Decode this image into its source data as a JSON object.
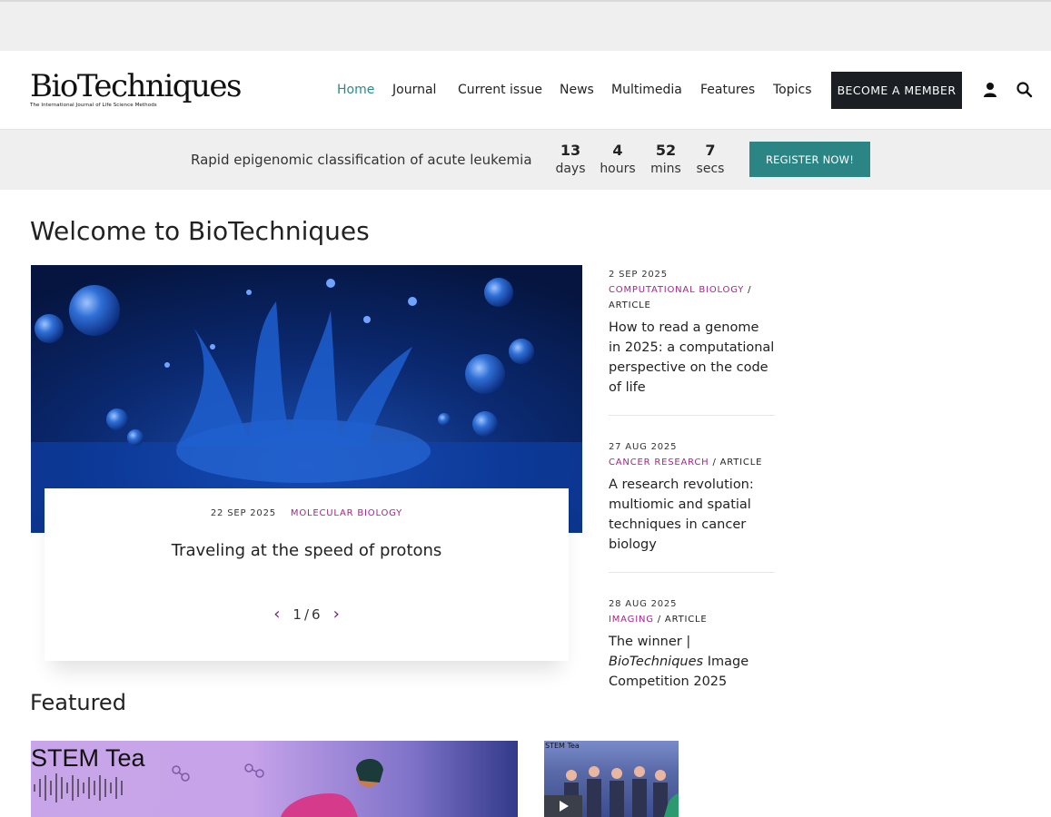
{
  "brand": {
    "name": "BioTechniques",
    "tagline": "The International Journal of Life Science Methods"
  },
  "nav": {
    "items": [
      "Home",
      "Journal",
      "Current issue",
      "News",
      "Multimedia",
      "Features",
      "Topics"
    ],
    "member_label": "BECOME A MEMBER",
    "active_color": "#2a8a8a"
  },
  "banner": {
    "text": "Rapid epigenomic classification of acute leukemia",
    "countdown": [
      {
        "value": "13",
        "unit": "days"
      },
      {
        "value": "4",
        "unit": "hours"
      },
      {
        "value": "52",
        "unit": "mins"
      },
      {
        "value": "7",
        "unit": "secs"
      }
    ],
    "cta": "REGISTER NOW!",
    "cta_color": "#2b8585"
  },
  "welcome": {
    "title": "Welcome to BioTechniques"
  },
  "hero": {
    "date": "22 SEP 2025",
    "category": "MOLECULAR BIOLOGY",
    "title": "Traveling at the speed of protons",
    "pager": {
      "current": "1",
      "separator": "/",
      "total": "6"
    }
  },
  "side_articles": [
    {
      "date": "2 SEP 2025",
      "category": "COMPUTATIONAL BIOLOGY",
      "type": "ARTICLE",
      "title": "How to read a genome in 2025: a computational perspective on the code of life"
    },
    {
      "date": "27 AUG 2025",
      "category": "CANCER RESEARCH",
      "type": "ARTICLE",
      "title": "A research revolution: multiomic and spatial techniques in cancer biology"
    },
    {
      "date": "28 AUG 2025",
      "category": "IMAGING",
      "type": "ARTICLE",
      "title_pre": "The winner | ",
      "title_em": "BioTechniques",
      "title_post": " Image Competition 2025"
    }
  ],
  "featured": {
    "title": "Featured",
    "card1_label": "STEM Tea",
    "card2_label": "STEM Tea"
  },
  "colors": {
    "accent_magenta": "#a3238f",
    "dark_button": "#1b1f24"
  }
}
